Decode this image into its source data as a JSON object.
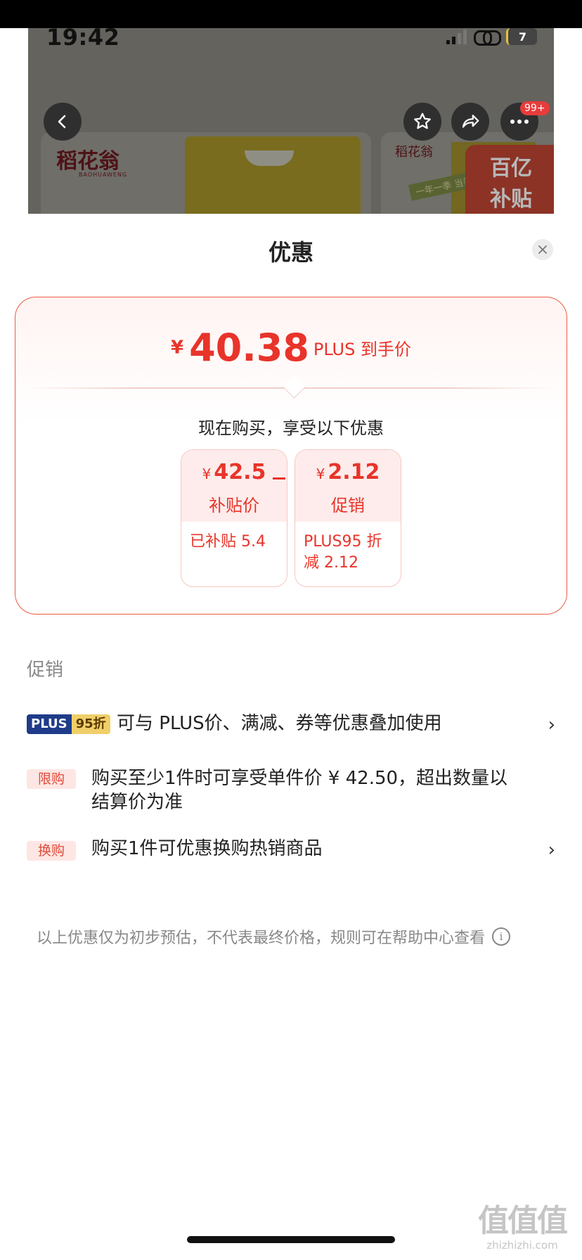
{
  "status_bar": {
    "time": "19:42",
    "battery": "7"
  },
  "background_page": {
    "brand": "稻花翁",
    "brand_pinyin": "BAOHUAWENG",
    "badge": "99+",
    "tile2_brand": "稻花翁",
    "tile2_ribbon": "一年一季 当季新米",
    "tile2_tag_line1": "百亿",
    "tile2_tag_line2": "补贴"
  },
  "sheet": {
    "title": "优惠",
    "summary": {
      "currency": "¥",
      "final_price": "40.38",
      "final_label": "PLUS 到手价",
      "intro": "现在购买，享受以下优惠"
    },
    "breakdown": [
      {
        "currency": "¥",
        "amount": "42.5",
        "caption": "补贴价",
        "detail": "已补贴 5.4"
      },
      {
        "currency": "¥",
        "amount": "2.12",
        "caption": "促销",
        "detail": "PLUS95 折减 2.12"
      }
    ],
    "promotions_label": "促销",
    "promotions": [
      {
        "tag_a": "PLUS",
        "tag_b": "95折",
        "text": "可与 PLUS价、满减、券等优惠叠加使用",
        "arrow": "›"
      },
      {
        "tag": "限购",
        "text": "购买至少1件时可享受单件价 ¥ 42.50，超出数量以结算价为准"
      },
      {
        "tag": "换购",
        "text": "购买1件可优惠换购热销商品",
        "arrow": "›"
      }
    ],
    "disclaimer": "以上优惠仅为初步预估，不代表最终价格，规则可在帮助中心查看"
  },
  "watermark": {
    "logo": "值值值",
    "url": "zhizhizhi.com"
  },
  "colors": {
    "accent": "#e8342a",
    "card_border": "#ec5b47",
    "plus_blue": "#1f3c8a",
    "plus_gold": "#f0cf6a"
  }
}
